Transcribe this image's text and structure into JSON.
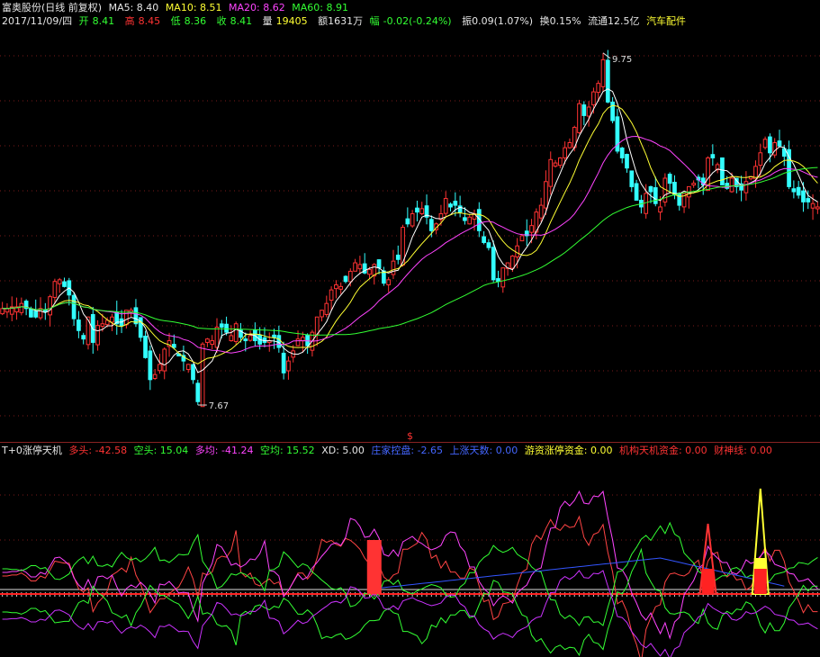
{
  "header": {
    "stock_title": "富奥股份(日线 前复权)",
    "ma5_label": "MA5: 8.40",
    "ma10_label": "MA10: 8.51",
    "ma20_label": "MA20: 8.62",
    "ma60_label": "MA60: 8.91",
    "date": "2017/11/09/四",
    "open_key": "开",
    "open_val": "8.41",
    "high_key": "高",
    "high_val": "8.45",
    "low_key": "低",
    "low_val": "8.36",
    "close_key": "收",
    "close_val": "8.41",
    "vol_key": "量",
    "vol_val": "19405",
    "amount": "额1631万",
    "change_key": "幅",
    "change_val": "-0.02(-0.24%)",
    "amplitude": "振0.09(1.07%)",
    "turnover": "换0.15%",
    "float_cap": "流通12.5亿",
    "sector": "汽车配件"
  },
  "indicator_header": {
    "name": "T+0涨停天机",
    "duotou": "多头: -42.58",
    "kongtou": "空头: 15.04",
    "duojun": "多均: -41.24",
    "kongjun": "空均: 15.52",
    "xd": "XD: 5.00",
    "zhuangjia": "庄家控盘: -2.65",
    "shangzhang": "上涨天数: 0.00",
    "youzi": "游资涨停资金: 0.00",
    "jigou": "机构天机资金: 0.00",
    "caishen": "财神线: 0.00"
  },
  "colors": {
    "up": "#ff3333",
    "down": "#33ffff",
    "ma5": "#ffffff",
    "ma10": "#ffff33",
    "ma20": "#ff44ff",
    "ma60": "#33ff33"
  },
  "chart_data": {
    "type": "candlestick",
    "title": "富奥股份(日线 前复权)",
    "price_annotations": {
      "high": "9.75",
      "low": "7.67"
    },
    "ylim": [
      7.5,
      9.85
    ],
    "close": [
      8.24,
      8.24,
      8.25,
      8.25,
      8.27,
      8.24,
      8.19,
      8.19,
      8.24,
      8.22,
      8.31,
      8.4,
      8.41,
      8.37,
      8.32,
      8.18,
      8.11,
      8.06,
      8.19,
      8.04,
      8.14,
      8.15,
      8.17,
      8.19,
      8.15,
      8.14,
      8.23,
      8.23,
      8.15,
      8.07,
      7.95,
      7.82,
      7.85,
      7.91,
      8.0,
      8.05,
      8.01,
      7.96,
      7.93,
      7.91,
      7.82,
      7.69,
      8.03,
      8.06,
      8.05,
      8.13,
      8.13,
      8.1,
      8.08,
      8.15,
      8.07,
      8.05,
      8.08,
      8.05,
      8.03,
      8.04,
      8.05,
      8.07,
      8.01,
      7.86,
      7.93,
      7.99,
      8.06,
      8.07,
      8.02,
      8.1,
      8.19,
      8.23,
      8.27,
      8.35,
      8.38,
      8.37,
      8.4,
      8.46,
      8.51,
      8.5,
      8.45,
      8.47,
      8.5,
      8.48,
      8.39,
      8.41,
      8.52,
      8.53,
      8.72,
      8.74,
      8.8,
      8.81,
      8.83,
      8.78,
      8.7,
      8.74,
      8.8,
      8.89,
      8.84,
      8.85,
      8.81,
      8.76,
      8.78,
      8.8,
      8.7,
      8.63,
      8.6,
      8.41,
      8.4,
      8.48,
      8.51,
      8.55,
      8.61,
      8.67,
      8.67,
      8.73,
      8.81,
      8.85,
      8.99,
      9.12,
      9.1,
      9.13,
      9.19,
      9.22,
      9.31,
      9.45,
      9.38,
      9.43,
      9.52,
      9.57,
      9.71,
      9.46,
      9.35,
      9.17,
      9.13,
      9.07,
      8.96,
      8.88,
      8.84,
      8.92,
      8.93,
      8.86,
      8.84,
      9.01,
      8.98,
      8.91,
      8.85,
      8.92,
      8.96,
      8.98,
      9.0,
      8.97,
      9.13,
      9.13,
      9.09,
      8.97,
      8.95,
      9.01,
      8.96,
      8.94,
      8.99,
      9.02,
      9.08,
      9.16,
      9.24,
      9.16,
      9.22,
      9.2,
      9.14,
      8.96,
      8.93,
      8.91,
      8.87,
      8.87,
      8.86,
      8.84
    ],
    "series": [
      {
        "name": "MA5",
        "color": "#ffffff"
      },
      {
        "name": "MA10",
        "color": "#ffff33"
      },
      {
        "name": "MA20",
        "color": "#ff44ff"
      },
      {
        "name": "MA60",
        "color": "#33ff33"
      }
    ]
  },
  "indicator_data": {
    "spikes": [
      {
        "index": 78,
        "top": 1.0,
        "color": "#ff3333",
        "kind": "bar"
      },
      {
        "index": 148,
        "top": 1.3,
        "color": "#ff3333",
        "kind": "triangle"
      },
      {
        "index": 159,
        "top": 1.95,
        "color": "#ffff33",
        "kind": "triangle"
      }
    ]
  }
}
